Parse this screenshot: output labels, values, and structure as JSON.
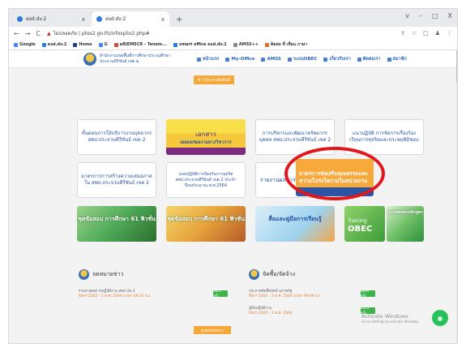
{
  "tabs": [
    {
      "title": "esd.dv.2",
      "close": "x"
    },
    {
      "title": "esd.dv.2",
      "close": "x"
    }
  ],
  "newtab": "+",
  "window_controls": [
    "v",
    "–",
    "□",
    "X"
  ],
  "address": {
    "nav": [
      "←",
      "→",
      "C"
    ],
    "security": "ไม่ปลอดภัย",
    "url": "ptes2.go.th/infoxplio2.php#",
    "right_icons": [
      "⇪",
      "☆",
      "□",
      "♟",
      "⋮"
    ]
  },
  "bookmarks": [
    "Google",
    "esd.dv.2",
    "Home",
    "G",
    "eRIEMSCR - Tenem...",
    "smart office esd.dv.2",
    "AMSS++",
    "ติดต่อ ที่ เขื่อน ภาษา"
  ],
  "site": {
    "name_line1": "สำนักงานเขตพื้นที่การศึกษาประถมศึกษา",
    "name_line2": "ประจวบคีรีขันธ์ เขต ๒",
    "menu": [
      "หน้าแรก",
      "My-Office",
      "AMSS",
      "ระบบOBEC",
      "เกี่ยวกับเรา",
      "ติดต่อเรา",
      "สมาชิก"
    ],
    "top_button": "ข่าวประชาสัมพันธ์"
  },
  "cards": {
    "c1": "ขั้นตอนการให้บริการงานบุคลากร สพป.ประจวบคีรีขันธ์ เขต 2",
    "c2_title": "เอกสาร",
    "c2_sub": "เผยแพร่ผลงานทางวิชาการ",
    "c3": "การบริหารและพัฒนาทรัพยากรบุคคล สพป.ประจวบคีรีขันธ์ เขต 2",
    "c4": "แนวปฏิบัติ การจัดการเรื่องร้องเรียนการทุจริตและประพฤติมิชอบ",
    "c5": "มาตรการการสร้างความเสมอภาคใน สพป.ประจวบคีรีขันธ์ เขต 2",
    "c6": "แผนปฏิบัติการป้องกันการทุจริต สพป.ประจวบคีรีขันธ์ เขต 2 ประจำปีงบประมาณ พ.ศ.2564",
    "c7": "รายงานผลการฝึกอบรมศึกษา",
    "c8_line1": "มาตรการส่งเสริมคุณธรรมและ",
    "c8_line2": "ความโปร่งใสภายในหน่วยงาน",
    "c9": "ชุดข้อสอบ การศึกษา 61 ฟิวชั่น",
    "c10": "ชุดข้อสอบ การศึกษา 61 ฟิวชั่น",
    "c11": "สื่อและคู่มือการเรียนรู้",
    "c12_title": "Training",
    "c12_sub": "OBEC",
    "c12_extra": "แบบทดสอบหลักสูตร"
  },
  "sections": {
    "left": "จดหมายข่าว",
    "right": "จัดซื้อ/จัดจ้าง",
    "left_items": [
      {
        "title": "รายงานผลการปฏิบัติงาน สพป.ปข.2",
        "date": "ปีงบฯ 2565 - 1 ต.ค. 2564 (เวลา 09:31 น.)",
        "btn": "3822 ครั้ง"
      }
    ],
    "right_items": [
      {
        "title": "ประกาศจัดซื้อจัดจ้างภาครัฐ",
        "date": "ปีงบฯ 2565 - 1 ต.ค. 2564 (เวลา 09:09 น.)",
        "btn": "3834 ครั้ง"
      },
      {
        "title": "คู่มือปฏิบัติงาน",
        "date": "ปีงบฯ 2565 - 1 ต.ค. 2564",
        "btn": "4023 ครั้ง"
      }
    ],
    "more_button": "ดูจดหมายข่าว"
  },
  "watermark": {
    "line1": "Activate Windows",
    "line2": "Go to Settings to activate Windows."
  },
  "colors": {
    "accent_orange": "#f4a83a",
    "ring_red": "#e3161d",
    "link_blue": "#2a55a5",
    "button_green": "#3cb44a"
  }
}
